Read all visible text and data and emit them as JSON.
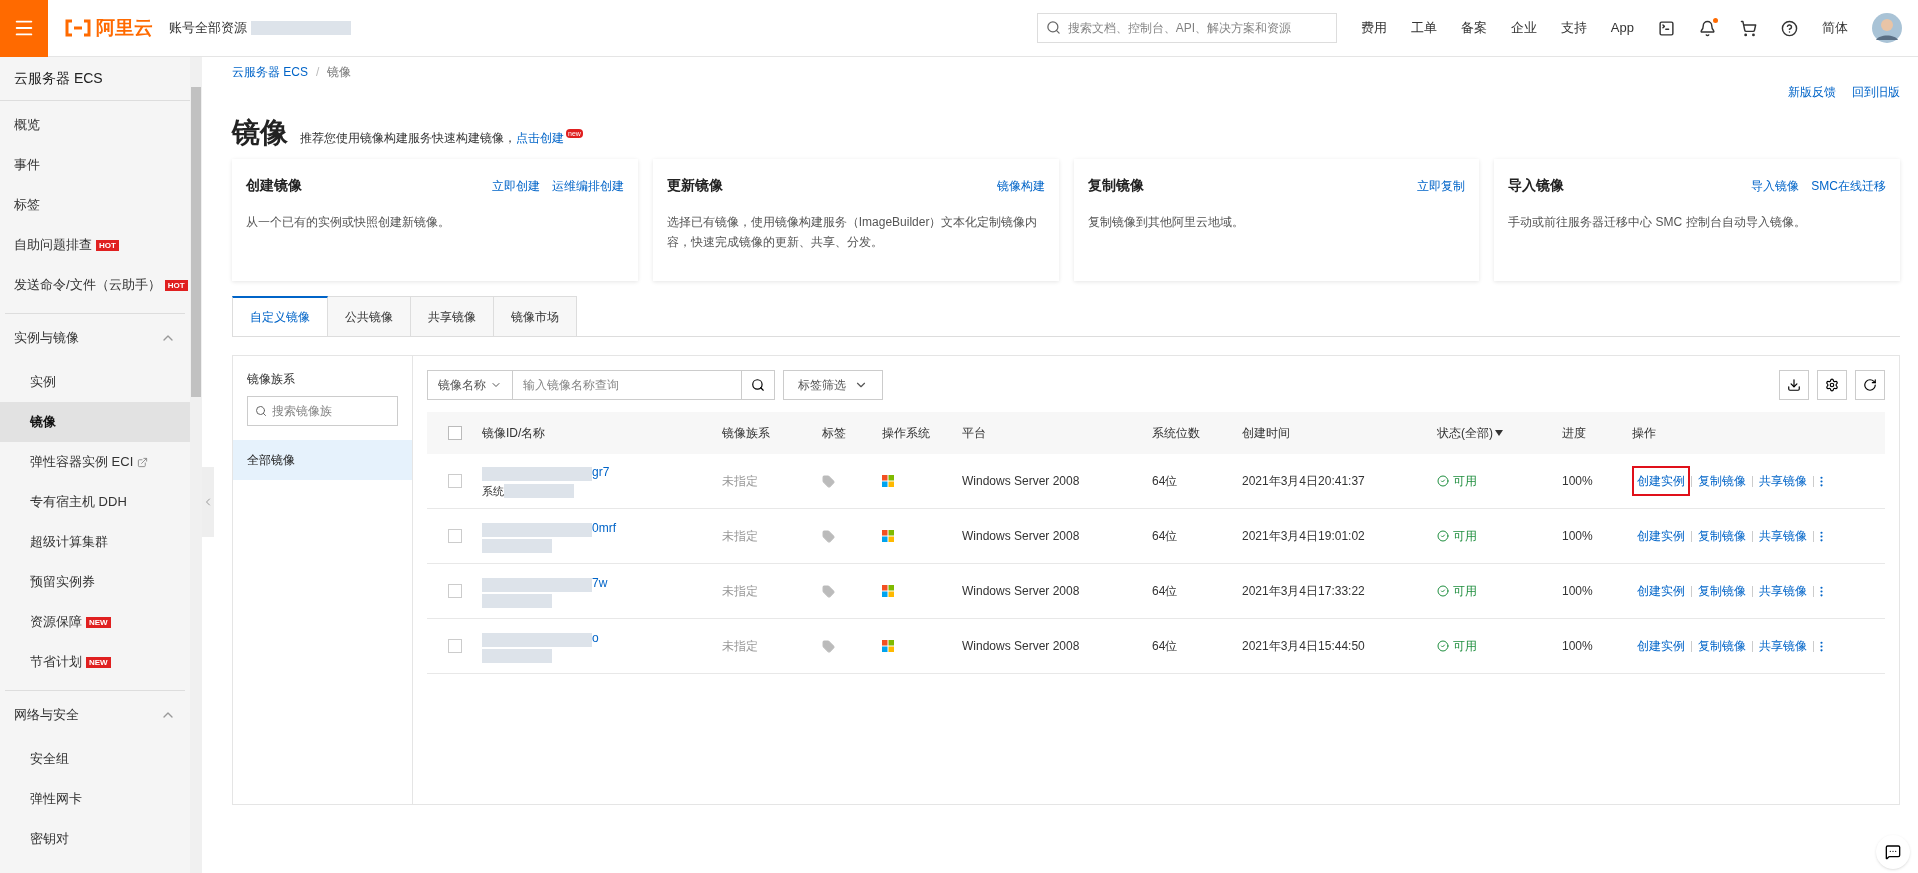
{
  "header": {
    "brand": "阿里云",
    "account": "账号全部资源",
    "search_placeholder": "搜索文档、控制台、API、解决方案和资源",
    "nav": [
      "费用",
      "工单",
      "备案",
      "企业",
      "支持",
      "App"
    ],
    "notification_dot": true,
    "language": "简体"
  },
  "sidebar": {
    "title": "云服务器 ECS",
    "items": [
      {
        "kind": "item",
        "label": "概览",
        "selected": false
      },
      {
        "kind": "item",
        "label": "事件",
        "selected": false
      },
      {
        "kind": "item",
        "label": "标签",
        "selected": false
      },
      {
        "kind": "item",
        "label": "自助问题排查",
        "badge": "HOT",
        "selected": false
      },
      {
        "kind": "item",
        "label": "发送命令/文件（云助手）",
        "badge": "HOT",
        "selected": false
      },
      {
        "kind": "group",
        "label": "实例与镜像",
        "expanded": true,
        "children": [
          {
            "label": "实例",
            "selected": false
          },
          {
            "label": "镜像",
            "selected": true
          },
          {
            "label": "弹性容器实例 ECI",
            "external": true,
            "selected": false
          },
          {
            "label": "专有宿主机 DDH",
            "selected": false
          },
          {
            "label": "超级计算集群",
            "selected": false
          },
          {
            "label": "预留实例券",
            "selected": false
          },
          {
            "label": "资源保障",
            "badge": "NEW",
            "selected": false
          },
          {
            "label": "节省计划",
            "badge": "NEW",
            "selected": false
          }
        ]
      },
      {
        "kind": "group",
        "label": "网络与安全",
        "expanded": true,
        "children": [
          {
            "label": "安全组",
            "selected": false
          },
          {
            "label": "弹性网卡",
            "selected": false
          },
          {
            "label": "密钥对",
            "selected": false
          }
        ]
      }
    ]
  },
  "breadcrumb": {
    "separator": "/",
    "items": [
      {
        "label": "云服务器 ECS",
        "link": true
      },
      {
        "label": "镜像",
        "link": false
      }
    ]
  },
  "top_links": [
    "新版反馈",
    "回到旧版"
  ],
  "page": {
    "title": "镜像",
    "subtitle": "推荐您使用镜像构建服务快速构建镜像，",
    "subtitle_link": "点击创建",
    "badge": "new"
  },
  "cards": [
    {
      "title": "创建镜像",
      "links": [
        "立即创建",
        "运维编排创建"
      ],
      "description": "从一个已有的实例或快照创建新镜像。"
    },
    {
      "title": "更新镜像",
      "links": [
        "镜像构建"
      ],
      "description": "选择已有镜像，使用镜像构建服务（ImageBuilder）文本化定制镜像内容，快速完成镜像的更新、共享、分发。"
    },
    {
      "title": "复制镜像",
      "links": [
        "立即复制"
      ],
      "description": "复制镜像到其他阿里云地域。"
    },
    {
      "title": "导入镜像",
      "links": [
        "导入镜像",
        "SMC在线迁移"
      ],
      "description": "手动或前往服务器迁移中心 SMC 控制台自动导入镜像。"
    }
  ],
  "tabs": [
    {
      "label": "自定义镜像",
      "selected": true
    },
    {
      "label": "公共镜像",
      "selected": false
    },
    {
      "label": "共享镜像",
      "selected": false
    },
    {
      "label": "镜像市场",
      "selected": false
    }
  ],
  "families": {
    "label": "镜像族系",
    "search_placeholder": "搜索镜像族",
    "items": [
      {
        "label": "全部镜像",
        "selected": true
      }
    ]
  },
  "toolbar": {
    "field_select": "镜像名称",
    "search_placeholder": "输入镜像名称查询",
    "tag_filter": "标签筛选"
  },
  "table": {
    "all_checked": false,
    "columns": [
      "镜像ID/名称",
      "镜像族系",
      "标签",
      "操作系统",
      "平台",
      "系统位数",
      "创建时间",
      "状态(全部)",
      "进度",
      "操作"
    ],
    "rows": [
      {
        "checked": false,
        "id_fragment": "gr7",
        "name_fragment": "系统",
        "family": "未指定",
        "platform": "Windows Server 2008",
        "bits": "64位",
        "created": "2021年3月4日20:41:37",
        "status": "可用",
        "progress": "100%",
        "actions": [
          {
            "label": "创建实例",
            "highlighted": true
          },
          {
            "label": "复制镜像",
            "highlighted": false
          },
          {
            "label": "共享镜像",
            "highlighted": false
          }
        ]
      },
      {
        "checked": false,
        "id_fragment": "0mrf",
        "name_fragment": "",
        "family": "未指定",
        "platform": "Windows Server 2008",
        "bits": "64位",
        "created": "2021年3月4日19:01:02",
        "status": "可用",
        "progress": "100%",
        "actions": [
          {
            "label": "创建实例",
            "highlighted": false
          },
          {
            "label": "复制镜像",
            "highlighted": false
          },
          {
            "label": "共享镜像",
            "highlighted": false
          }
        ]
      },
      {
        "checked": false,
        "id_fragment": "7w",
        "name_fragment": "",
        "family": "未指定",
        "platform": "Windows Server 2008",
        "bits": "64位",
        "created": "2021年3月4日17:33:22",
        "status": "可用",
        "progress": "100%",
        "actions": [
          {
            "label": "创建实例",
            "highlighted": false
          },
          {
            "label": "复制镜像",
            "highlighted": false
          },
          {
            "label": "共享镜像",
            "highlighted": false
          }
        ]
      },
      {
        "checked": false,
        "id_fragment": "o",
        "name_fragment": "",
        "family": "未指定",
        "platform": "Windows Server 2008",
        "bits": "64位",
        "created": "2021年3月4日15:44:50",
        "status": "可用",
        "progress": "100%",
        "actions": [
          {
            "label": "创建实例",
            "highlighted": false
          },
          {
            "label": "复制镜像",
            "highlighted": false
          },
          {
            "label": "共享镜像",
            "highlighted": false
          }
        ]
      }
    ]
  }
}
